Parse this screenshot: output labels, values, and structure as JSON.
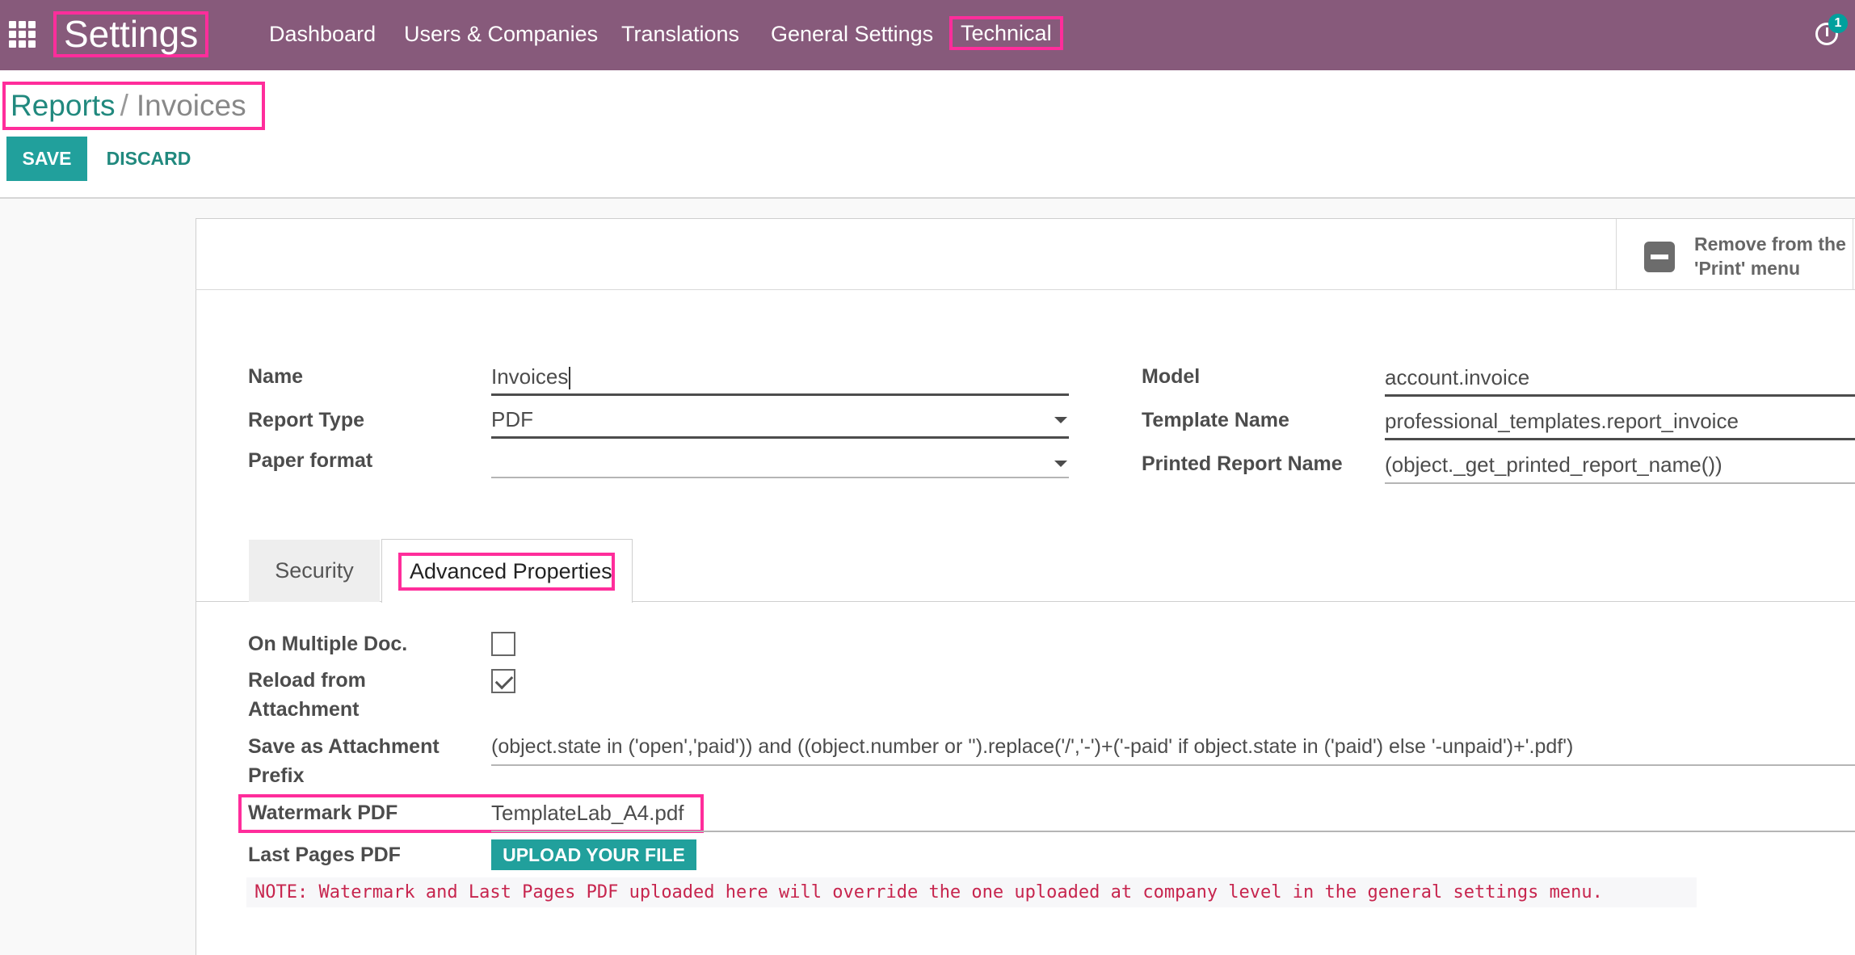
{
  "navbar": {
    "brand": "Settings",
    "menu": [
      "Dashboard",
      "Users & Companies",
      "Translations",
      "General Settings"
    ],
    "technical": "Technical",
    "activity_count": "1"
  },
  "breadcrumb": {
    "parent": "Reports",
    "separator": "/",
    "current": "Invoices"
  },
  "actions": {
    "save": "SAVE",
    "discard": "DISCARD"
  },
  "stat_button": {
    "label": "Remove from the 'Print' menu"
  },
  "form": {
    "name_label": "Name",
    "name_value": "Invoices",
    "report_type_label": "Report Type",
    "report_type_value": "PDF",
    "paper_format_label": "Paper format",
    "paper_format_value": "",
    "model_label": "Model",
    "model_value": "account.invoice",
    "template_label": "Template Name",
    "template_value": "professional_templates.report_invoice",
    "printed_name_label": "Printed Report Name",
    "printed_name_value": "(object._get_printed_report_name())"
  },
  "tabs": {
    "security": "Security",
    "advanced": "Advanced Properties"
  },
  "advanced": {
    "multi_doc_label": "On Multiple Doc.",
    "multi_doc_checked": false,
    "reload_label_1": "Reload from",
    "reload_label_2": "Attachment",
    "reload_checked": true,
    "prefix_label_1": "Save as Attachment",
    "prefix_label_2": "Prefix",
    "prefix_value": "(object.state in ('open','paid')) and ((object.number or '').replace('/','-')+('-paid' if object.state in ('paid') else '-unpaid')+'.pdf')",
    "watermark_label": "Watermark PDF",
    "watermark_value": "TemplateLab_A4.pdf",
    "last_pages_label": "Last Pages PDF",
    "upload_button": "UPLOAD YOUR FILE",
    "note": "NOTE: Watermark and Last Pages PDF uploaded here will override the one uploaded at company level in the general settings menu."
  },
  "colors": {
    "navbar": "#875a7b",
    "primary": "#21a09c",
    "highlight": "#ff2d9b",
    "note_text": "#c7254e"
  }
}
